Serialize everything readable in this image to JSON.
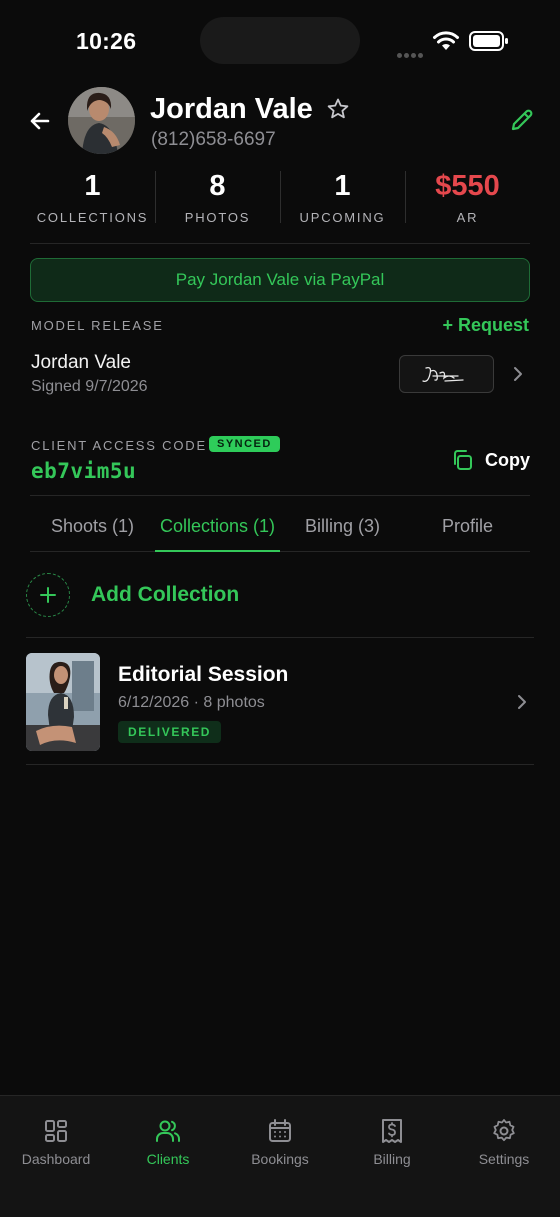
{
  "status_bar": {
    "time": "10:26"
  },
  "client": {
    "name": "Jordan Vale",
    "phone": "(812)658-6697"
  },
  "stats": [
    {
      "value": "1",
      "label": "COLLECTIONS"
    },
    {
      "value": "8",
      "label": "PHOTOS"
    },
    {
      "value": "1",
      "label": "UPCOMING"
    },
    {
      "value": "$550",
      "label": "AR"
    }
  ],
  "paypal_button": "Pay Jordan Vale via PayPal",
  "model_release": {
    "label": "MODEL RELEASE",
    "request_label": "+ Request",
    "name": "Jordan Vale",
    "signed": "Signed 9/7/2026"
  },
  "access": {
    "label": "CLIENT ACCESS CODE",
    "badge": "SYNCED",
    "code": "eb7vim5u",
    "copy_label": "Copy"
  },
  "tabs": [
    {
      "label": "Shoots (1)"
    },
    {
      "label": "Collections (1)",
      "active": true
    },
    {
      "label": "Billing (3)"
    },
    {
      "label": "Profile"
    }
  ],
  "add_collection_label": "Add Collection",
  "collections": [
    {
      "title": "Editorial Session",
      "meta": "6/12/2026 · 8 photos",
      "status": "DELIVERED"
    }
  ],
  "bottom_nav": [
    {
      "label": "Dashboard",
      "icon": "dashboard-icon"
    },
    {
      "label": "Clients",
      "icon": "users-icon",
      "active": true
    },
    {
      "label": "Bookings",
      "icon": "calendar-icon"
    },
    {
      "label": "Billing",
      "icon": "receipt-icon"
    },
    {
      "label": "Settings",
      "icon": "gear-icon"
    }
  ],
  "colors": {
    "accent": "#34c759",
    "ar_red": "#e5484d",
    "background": "#0b0b0b"
  }
}
